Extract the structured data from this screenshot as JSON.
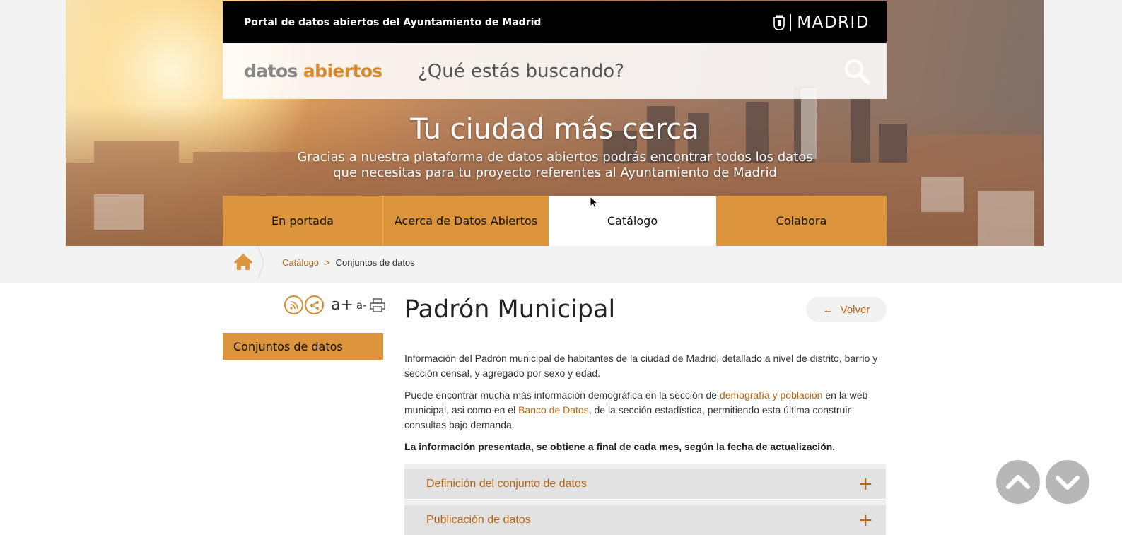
{
  "header": {
    "portal_title": "Portal de datos abiertos del Ayuntamiento de Madrid",
    "madrid_logo_text": "MADRID"
  },
  "search": {
    "logo_word1": "datos",
    "logo_word2": "abiertos",
    "placeholder": "¿Qué estás buscando?",
    "search_icon": "magnifier-icon"
  },
  "hero": {
    "title": "Tu ciudad más cerca",
    "subtitle_line1": "Gracias a nuestra plataforma de datos abiertos podrás encontrar todos los datos",
    "subtitle_line2": "que necesitas para tu proyecto referentes al Ayuntamiento de Madrid"
  },
  "nav": {
    "items": [
      {
        "label": "En portada",
        "active": false
      },
      {
        "label": "Acerca de Datos Abiertos",
        "active": false
      },
      {
        "label": "Catálogo",
        "active": true
      },
      {
        "label": "Colabora",
        "active": false
      }
    ]
  },
  "breadcrumb": {
    "home_icon": "home-icon",
    "link": "Catálogo",
    "separator": ">",
    "current": "Conjuntos de datos"
  },
  "tools": {
    "increase_font": "a+",
    "decrease_font": "a-"
  },
  "sidebar": {
    "items": [
      {
        "label": "Conjuntos de datos"
      }
    ]
  },
  "main": {
    "title": "Padrón Municipal",
    "back_arrow": "←",
    "back_label": "Volver",
    "p1": "Información del Padrón municipal de habitantes de la ciudad de Madrid, detallado a nivel de distrito, barrio y sección censal, y agregado por sexo y edad.",
    "p2_a": "Puede encontrar mucha más información demográfica en la sección de ",
    "p2_link1": "demografía y población",
    "p2_b": " en la web municipal, asi como en el ",
    "p2_link2": "Banco de Datos",
    "p2_c": ", de la sección estadística, permitiendo esta última construir consultas bajo demanda.",
    "p3": "La información presentada, se obtiene a final de cada mes, según la fecha de actualización.",
    "accordion": [
      {
        "label": "Definición del conjunto de datos",
        "icon": "+"
      },
      {
        "label": "Publicación de datos",
        "icon": "+"
      }
    ]
  },
  "colors": {
    "accent": "#dd953d",
    "link": "#b4640f",
    "topbar": "#000000"
  }
}
